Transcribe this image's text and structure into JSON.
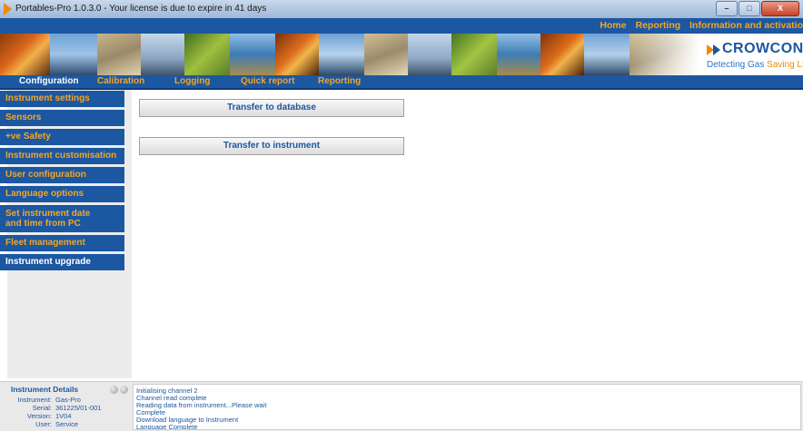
{
  "window": {
    "title": "Portables-Pro 1.0.3.0 - Your license is due to expire in 41 days",
    "minimize_label": "–",
    "maximize_label": "□",
    "close_label": "X"
  },
  "top_links": [
    {
      "label": "Home"
    },
    {
      "label": "Reporting"
    },
    {
      "label": "Information and activatio"
    }
  ],
  "logo": {
    "name": "CROWCON",
    "tagline_plain": "Detecting Gas ",
    "tagline_accent": "Saving Lives"
  },
  "main_nav": {
    "items": [
      {
        "label": "Configuration",
        "active": true
      },
      {
        "label": "Calibration",
        "active": false
      },
      {
        "label": "Logging",
        "active": false
      },
      {
        "label": "Quick report",
        "active": false
      },
      {
        "label": "Reporting",
        "active": false
      }
    ]
  },
  "sidebar": {
    "items": [
      {
        "label": "Instrument settings"
      },
      {
        "label": "Sensors"
      },
      {
        "label": "+ve Safety"
      },
      {
        "label": "Instrument customisation"
      },
      {
        "label": "User configuration"
      },
      {
        "label": "Language options"
      },
      {
        "label_line1": "Set instrument date",
        "label_line2": "and time from PC"
      },
      {
        "label": "Fleet management"
      },
      {
        "label": "Instrument upgrade",
        "selected": true
      }
    ]
  },
  "actions": {
    "transfer_to_database": "Transfer to database",
    "transfer_to_instrument": "Transfer to instrument"
  },
  "instrument_details": {
    "title": "Instrument Details",
    "rows": [
      {
        "key": "Instrument:",
        "value": "Gas-Pro"
      },
      {
        "key": "Serial:",
        "value": "361225/01-001"
      },
      {
        "key": "Version:",
        "value": "1V04"
      },
      {
        "key": "User:",
        "value": "Service"
      }
    ]
  },
  "log": {
    "lines": [
      "Initialising channel  2",
      "Channel read complete",
      "Reading data from instrument...Please wait",
      "Complete",
      "Download language to Instrument",
      "Language Complete"
    ]
  },
  "colors": {
    "brand_blue": "#1c57a1",
    "accent_orange": "#f5a623",
    "logo_orange": "#f08a00"
  }
}
